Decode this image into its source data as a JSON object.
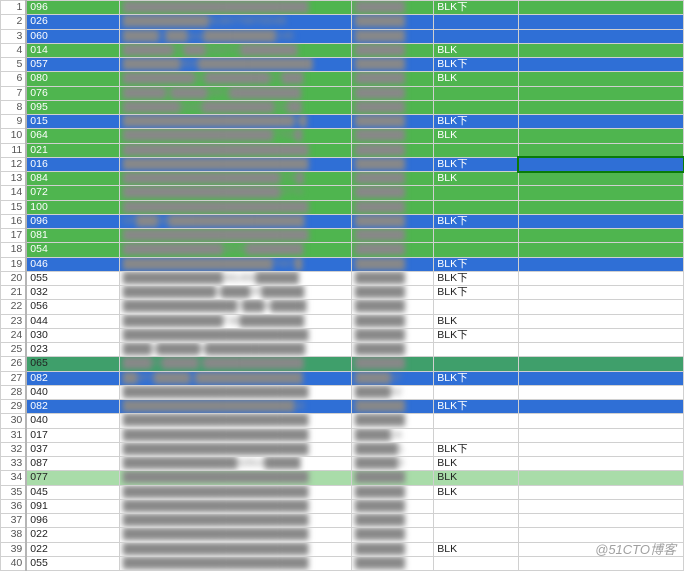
{
  "watermark": "@51CTO博客",
  "highlight_map": {
    "blue": [
      2,
      3,
      5,
      9,
      12,
      16,
      19,
      27,
      29
    ],
    "green": [
      1,
      4,
      6,
      7,
      8,
      10,
      11,
      13,
      14,
      15,
      17,
      18
    ],
    "lgreen": [
      34
    ],
    "sel": [
      26
    ]
  },
  "active_cell_row": 12,
  "rows": [
    {
      "n": 1,
      "a": "096",
      "b": "██████████████████████████",
      "c": "███████",
      "d": "BLK下",
      "e": ""
    },
    {
      "n": 2,
      "a": "026",
      "b": "████████████8L8A77687DD4B",
      "c": "███████",
      "d": "",
      "e": ""
    },
    {
      "n": 3,
      "a": "060",
      "b": "█████C███ona██████████D4E",
      "c": "███████",
      "d": "",
      "e": ""
    },
    {
      "n": 4,
      "a": "014",
      "b": "███████07███21917C████████",
      "c": "███████",
      "d": "BLK",
      "e": ""
    },
    {
      "n": 5,
      "a": "057",
      "b": "████████8D4████████████████",
      "c": "███████",
      "d": "BLK下",
      "e": ""
    },
    {
      "n": 6,
      "a": "080",
      "b": "██████████86█████████A7███",
      "c": "███████",
      "d": "BLK",
      "e": ""
    },
    {
      "n": 7,
      "a": "076",
      "b": "██████9█████60F2██████████",
      "c": "███████",
      "d": "",
      "e": ""
    },
    {
      "n": 8,
      "a": "095",
      "b": "████████6046██████████DB██",
      "c": "███████",
      "d": "",
      "e": ""
    },
    {
      "n": 9,
      "a": "015",
      "b": "████████████████████████4█",
      "c": "███████",
      "d": "BLK下",
      "e": ""
    },
    {
      "n": 10,
      "a": "064",
      "b": "█████████████████████7768█",
      "c": "███████",
      "d": "BLK",
      "e": ""
    },
    {
      "n": 11,
      "a": "021",
      "b": "██████████████████████████",
      "c": "███████",
      "d": "",
      "e": ""
    },
    {
      "n": 12,
      "a": "016",
      "b": "██████████████████████████",
      "c": "███████",
      "d": "BLK下",
      "e": ""
    },
    {
      "n": 13,
      "a": "084",
      "b": "██████████████████████776█",
      "c": "███████",
      "d": "BLK",
      "e": ""
    },
    {
      "n": 14,
      "a": "072",
      "b": "██████████████████████A776",
      "c": "███████",
      "d": "",
      "e": ""
    },
    {
      "n": 15,
      "a": "100",
      "b": "██████████████████████████",
      "c": "███████",
      "d": "",
      "e": ""
    },
    {
      "n": 16,
      "a": "096",
      "b": "DF███68███████████████████",
      "c": "███████",
      "d": "BLK下",
      "e": ""
    },
    {
      "n": 17,
      "a": "081",
      "b": "██████████████████████████",
      "c": "███████",
      "d": "",
      "e": ""
    },
    {
      "n": 18,
      "a": "054",
      "b": "██████████████4E38████████",
      "c": "███████",
      "d": "",
      "e": ""
    },
    {
      "n": 19,
      "a": "046",
      "b": "█████████████████████7687█",
      "c": "███████",
      "d": "BLK下",
      "e": ""
    },
    {
      "n": 20,
      "a": "055",
      "b": "██████████████491456██████",
      "c": "███████",
      "d": "BLK下",
      "e": ""
    },
    {
      "n": 21,
      "a": "032",
      "b": "█████████████6████0F██████",
      "c": "███████",
      "d": "BLK下",
      "e": ""
    },
    {
      "n": 22,
      "a": "056",
      "b": "████████████████7███A█████",
      "c": "███████",
      "d": "",
      "e": ""
    },
    {
      "n": 23,
      "a": "044",
      "b": "██████████████F38█████████",
      "c": "███████",
      "d": "BLK",
      "e": ""
    },
    {
      "n": 24,
      "a": "030",
      "b": "██████████████████████████",
      "c": "███████",
      "d": "BLK下",
      "e": ""
    },
    {
      "n": 25,
      "a": "023",
      "b": "████3██████6██████████████",
      "c": "███████",
      "d": "",
      "e": ""
    },
    {
      "n": 26,
      "a": "065",
      "b": "████93█████3██████████████",
      "c": "███████",
      "d": "",
      "e": ""
    },
    {
      "n": 27,
      "a": "082",
      "b": "██8F0█████2███████████████",
      "c": "█████47",
      "d": "BLK下",
      "e": ""
    },
    {
      "n": 28,
      "a": "040",
      "b": "██████████████████████████",
      "c": "█████62",
      "d": "",
      "e": ""
    },
    {
      "n": 29,
      "a": "082",
      "b": "████████████████████████32",
      "c": "███████",
      "d": "BLK下",
      "e": ""
    },
    {
      "n": 30,
      "a": "040",
      "b": "██████████████████████████",
      "c": "███████",
      "d": "",
      "e": ""
    },
    {
      "n": 31,
      "a": "017",
      "b": "██████████████████████████",
      "c": "█████24",
      "d": "",
      "e": ""
    },
    {
      "n": 32,
      "a": "037",
      "b": "██████████████████████████",
      "c": "██████1",
      "d": "BLK下",
      "e": ""
    },
    {
      "n": 33,
      "a": "087",
      "b": "████████████████42914█████",
      "c": "██████3",
      "d": "BLK",
      "e": ""
    },
    {
      "n": 34,
      "a": "077",
      "b": "██████████████████████████",
      "c": "███████",
      "d": "BLK",
      "e": ""
    },
    {
      "n": 35,
      "a": "045",
      "b": "██████████████████████████",
      "c": "███████",
      "d": "BLK",
      "e": ""
    },
    {
      "n": 36,
      "a": "091",
      "b": "██████████████████████████",
      "c": "███████",
      "d": "",
      "e": ""
    },
    {
      "n": 37,
      "a": "096",
      "b": "██████████████████████████",
      "c": "███████",
      "d": "",
      "e": ""
    },
    {
      "n": 38,
      "a": "022",
      "b": "██████████████████████████",
      "c": "███████",
      "d": "",
      "e": ""
    },
    {
      "n": 39,
      "a": "022",
      "b": "██████████████████████████",
      "c": "███████",
      "d": "BLK",
      "e": ""
    },
    {
      "n": 40,
      "a": "055",
      "b": "██████████████████████████",
      "c": "███████",
      "d": "",
      "e": ""
    }
  ]
}
